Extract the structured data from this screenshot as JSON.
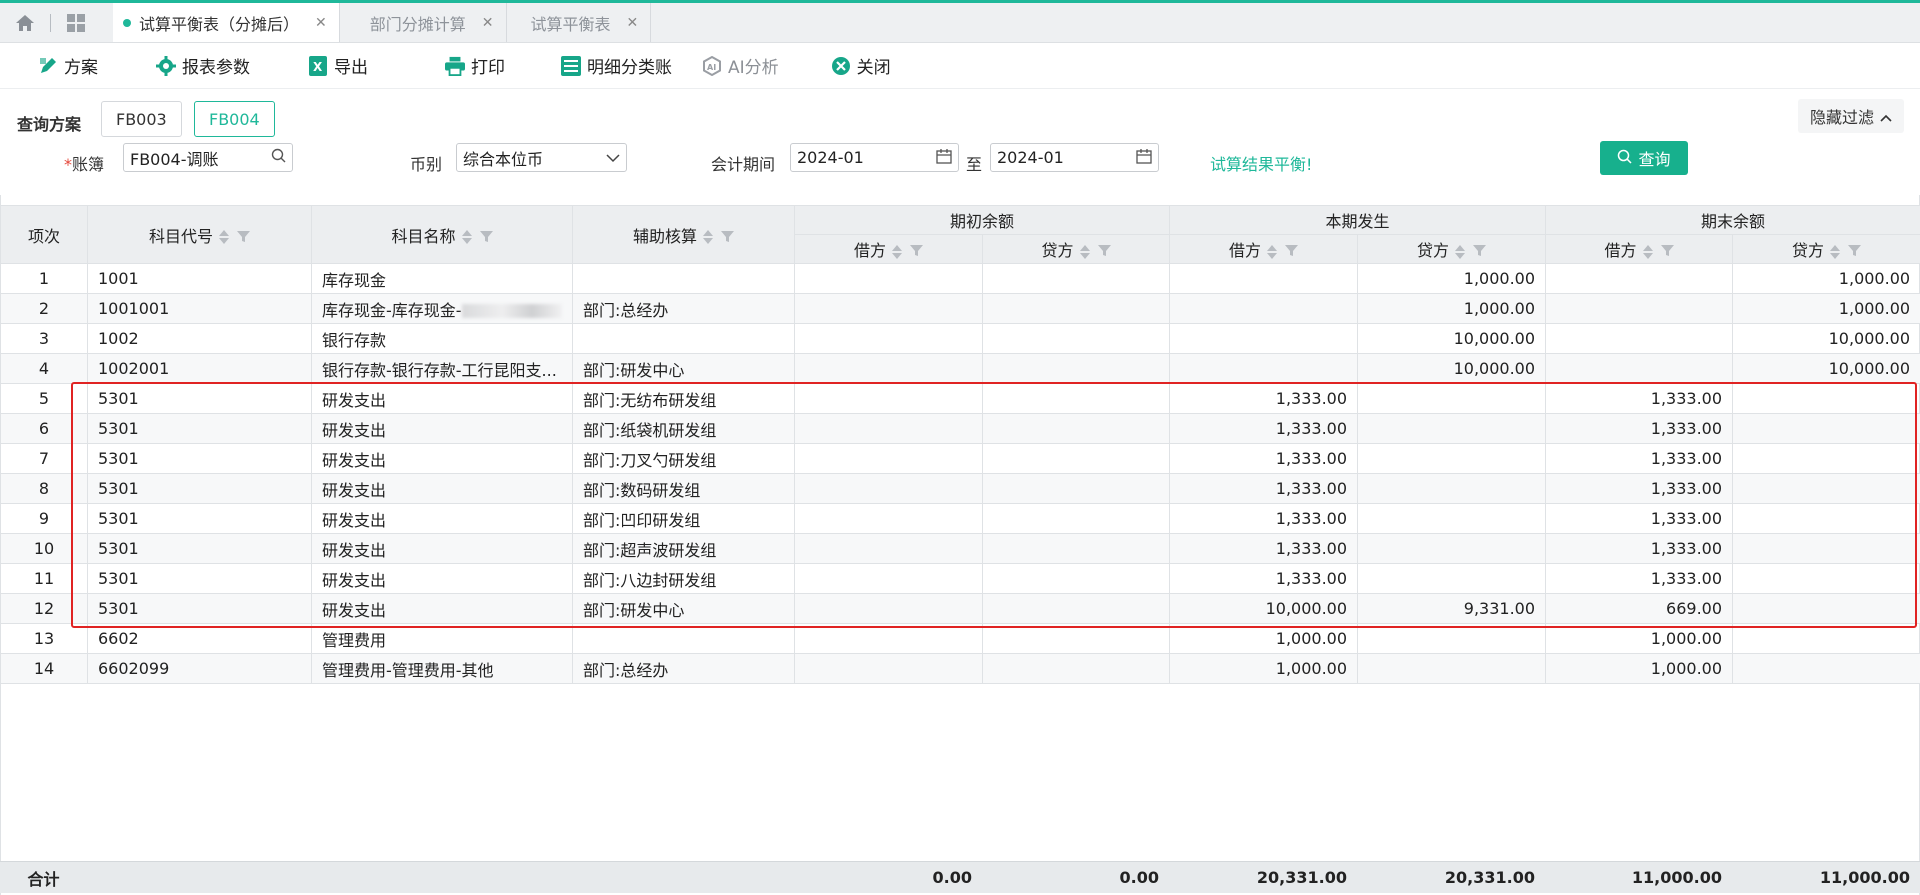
{
  "tabs": [
    {
      "label": "试算平衡表（分摊后）",
      "active": true
    },
    {
      "label": "部门分摊计算",
      "active": false
    },
    {
      "label": "试算平衡表",
      "active": false
    }
  ],
  "toolbar": {
    "scheme": "方案",
    "report_params": "报表参数",
    "export": "导出",
    "print": "打印",
    "detail_ledger": "明细分类账",
    "ai_analysis": "AI分析",
    "close": "关闭"
  },
  "filter": {
    "query_plan_label": "查询方案",
    "plans": [
      "FB003",
      "FB004"
    ],
    "active_plan": "FB004",
    "hide_filter": "隐藏过滤",
    "ledger_label": "账簿",
    "ledger_value": "FB004-调账",
    "currency_label": "币别",
    "currency_value": "综合本位币",
    "period_label": "会计期间",
    "period_from": "2024-01",
    "period_to_label": "至",
    "period_to": "2024-01",
    "status_text": "试算结果平衡!",
    "query_button": "查询"
  },
  "table": {
    "headers": {
      "seq": "项次",
      "code": "科目代号",
      "name": "科目名称",
      "aux": "辅助核算",
      "opening": "期初余额",
      "current": "本期发生",
      "closing": "期末余额",
      "debit": "借方",
      "credit": "贷方"
    },
    "rows": [
      [
        "1",
        "1001",
        "库存现金",
        "",
        "",
        "",
        "",
        "1,000.00",
        "",
        "1,000.00"
      ],
      [
        "2",
        "1001001",
        "库存现金-库存现金-",
        "部门:总经办",
        "",
        "",
        "",
        "1,000.00",
        "",
        "1,000.00"
      ],
      [
        "3",
        "1002",
        "银行存款",
        "",
        "",
        "",
        "",
        "10,000.00",
        "",
        "10,000.00"
      ],
      [
        "4",
        "1002001",
        "银行存款-银行存款-工行昆阳支...",
        "部门:研发中心",
        "",
        "",
        "",
        "10,000.00",
        "",
        "10,000.00"
      ],
      [
        "5",
        "5301",
        "研发支出",
        "部门:无纺布研发组",
        "",
        "",
        "1,333.00",
        "",
        "1,333.00",
        ""
      ],
      [
        "6",
        "5301",
        "研发支出",
        "部门:纸袋机研发组",
        "",
        "",
        "1,333.00",
        "",
        "1,333.00",
        ""
      ],
      [
        "7",
        "5301",
        "研发支出",
        "部门:刀叉勺研发组",
        "",
        "",
        "1,333.00",
        "",
        "1,333.00",
        ""
      ],
      [
        "8",
        "5301",
        "研发支出",
        "部门:数码研发组",
        "",
        "",
        "1,333.00",
        "",
        "1,333.00",
        ""
      ],
      [
        "9",
        "5301",
        "研发支出",
        "部门:凹印研发组",
        "",
        "",
        "1,333.00",
        "",
        "1,333.00",
        ""
      ],
      [
        "10",
        "5301",
        "研发支出",
        "部门:超声波研发组",
        "",
        "",
        "1,333.00",
        "",
        "1,333.00",
        ""
      ],
      [
        "11",
        "5301",
        "研发支出",
        "部门:八边封研发组",
        "",
        "",
        "1,333.00",
        "",
        "1,333.00",
        ""
      ],
      [
        "12",
        "5301",
        "研发支出",
        "部门:研发中心",
        "",
        "",
        "10,000.00",
        "9,331.00",
        "669.00",
        ""
      ],
      [
        "13",
        "6602",
        "管理费用",
        "",
        "",
        "",
        "1,000.00",
        "",
        "1,000.00",
        ""
      ],
      [
        "14",
        "6602099",
        "管理费用-管理费用-其他",
        "部门:总经办",
        "",
        "",
        "1,000.00",
        "",
        "1,000.00",
        ""
      ]
    ],
    "totals": {
      "label": "合计",
      "values": [
        "0.00",
        "0.00",
        "20,331.00",
        "20,331.00",
        "11,000.00",
        "11,000.00"
      ]
    }
  }
}
